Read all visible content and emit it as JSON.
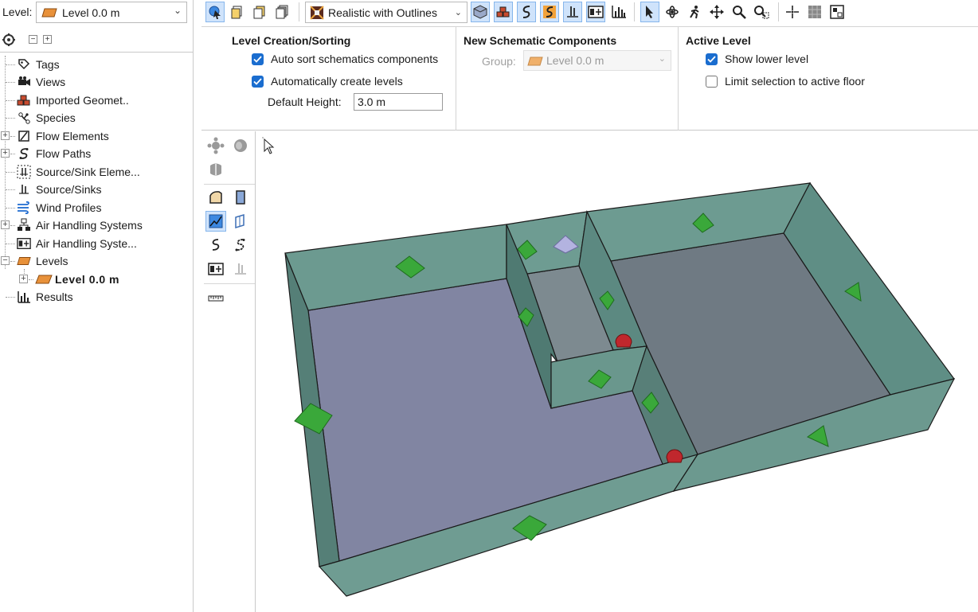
{
  "level_bar": {
    "label": "Level:",
    "selected": "Level 0.0 m"
  },
  "tree": {
    "items": [
      {
        "label": "Tags",
        "icon": "tag-icon"
      },
      {
        "label": "Views",
        "icon": "camera-icon"
      },
      {
        "label": "Imported Geomet..",
        "icon": "bricks-icon"
      },
      {
        "label": "Species",
        "icon": "molecule-icon"
      },
      {
        "label": "Flow Elements",
        "icon": "flow-element-icon"
      },
      {
        "label": "Flow Paths",
        "icon": "flow-path-icon"
      },
      {
        "label": "Source/Sink Eleme...",
        "icon": "source-sink-element-icon"
      },
      {
        "label": "Source/Sinks",
        "icon": "source-sink-icon"
      },
      {
        "label": "Wind Profiles",
        "icon": "wind-icon"
      },
      {
        "label": "Air Handling Systems",
        "icon": "ahs-icon"
      },
      {
        "label": "Air Handling Syste...",
        "icon": "ahs-element-icon"
      },
      {
        "label": "Levels",
        "icon": "level-icon"
      },
      {
        "label": "Level 0.0 m",
        "icon": "level-icon"
      },
      {
        "label": "Results",
        "icon": "chart-icon"
      }
    ]
  },
  "toolbar": {
    "render_mode": "Realistic with Outlines"
  },
  "options": {
    "level_creation": {
      "title": "Level Creation/Sorting",
      "auto_sort": {
        "label": "Auto sort schematics components",
        "checked": true
      },
      "auto_create": {
        "label": "Automatically create levels",
        "checked": true
      },
      "default_height_label": "Default Height:",
      "default_height_value": "3.0 m"
    },
    "new_schematic": {
      "title": "New Schematic Components",
      "group_label": "Group:",
      "group_value": "Level 0.0 m"
    },
    "active_level": {
      "title": "Active Level",
      "show_lower": {
        "label": "Show lower level",
        "checked": true
      },
      "limit_selection": {
        "label": "Limit selection to active floor",
        "checked": false
      }
    }
  },
  "colors": {
    "accent": "#1a6dcf",
    "wall": "#6f9c92",
    "floor": "#8286a3",
    "marker_green": "#3aa83a",
    "marker_red": "#c0272d",
    "marker_lavender": "#b3b3e0"
  }
}
